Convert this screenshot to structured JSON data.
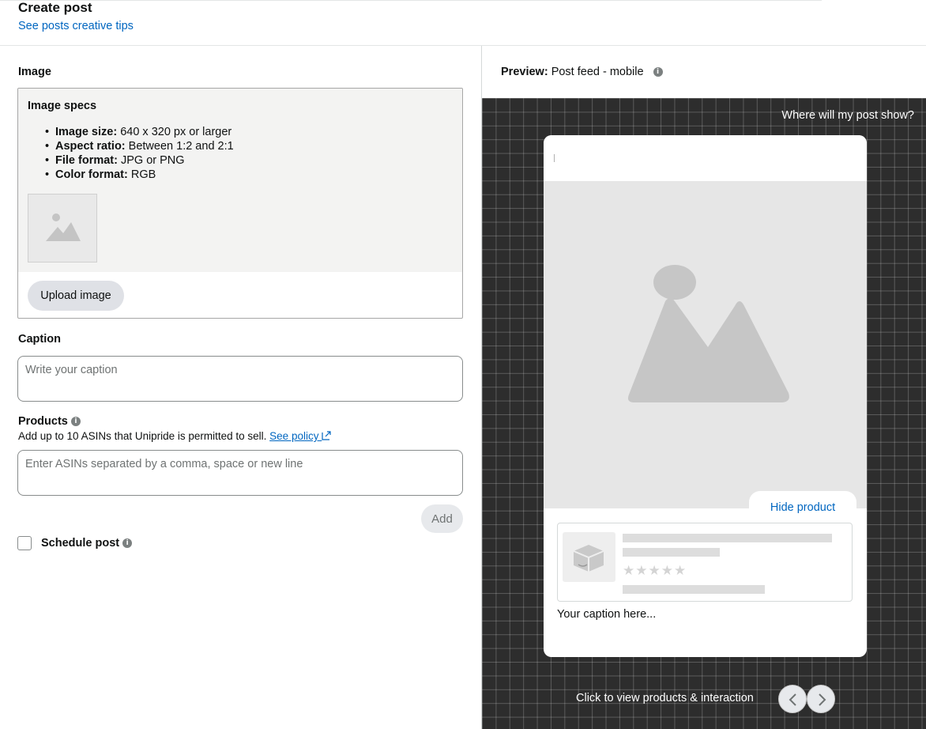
{
  "header": {
    "title": "Create post",
    "tips_link": "See posts creative tips"
  },
  "image_section": {
    "label": "Image",
    "specs_title": "Image specs",
    "specs": [
      {
        "key": "Image size:",
        "value": " 640 x 320 px or larger"
      },
      {
        "key": "Aspect ratio:",
        "value": " Between 1:2 and 2:1"
      },
      {
        "key": "File format:",
        "value": " JPG or PNG"
      },
      {
        "key": "Color format:",
        "value": " RGB"
      }
    ],
    "upload_label": "Upload image"
  },
  "caption": {
    "label": "Caption",
    "placeholder": "Write your caption"
  },
  "products": {
    "label": "Products",
    "helper": "Add up to 10 ASINs that Unipride is permitted to sell. ",
    "policy_link": "See policy",
    "placeholder": "Enter ASINs separated by a comma, space or new line",
    "add_label": "Add"
  },
  "schedule": {
    "label": "Schedule post",
    "checked": false
  },
  "preview": {
    "label": "Preview:",
    "mode": "Post feed - mobile",
    "where_link": "Where will my post show?",
    "hide_product": "Hide product",
    "caption_placeholder": "Your caption here...",
    "star_rating_placeholder": "★★★★★",
    "bottom_hint": "Click to view products & interaction"
  },
  "colors": {
    "link": "#0066c0",
    "canvas_bg": "#2d2d2d"
  }
}
